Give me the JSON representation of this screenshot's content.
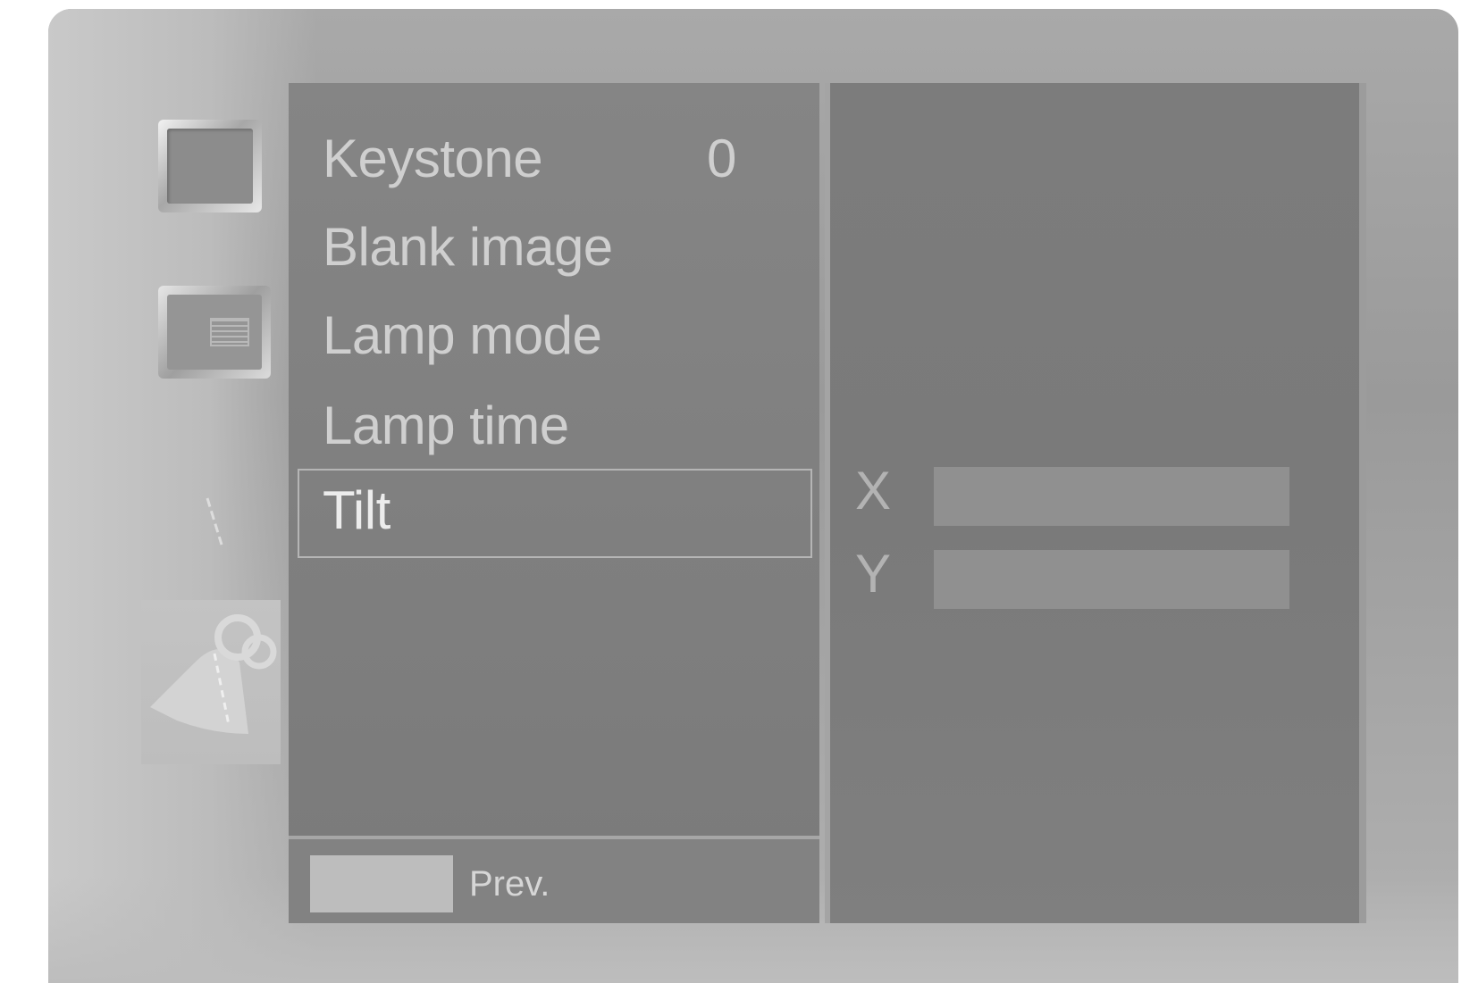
{
  "sidebar": {
    "icons": [
      {
        "name": "picture-icon"
      },
      {
        "name": "menu-icon"
      },
      {
        "name": "option-icon"
      },
      {
        "name": "bell-icon"
      }
    ]
  },
  "menu": {
    "items": [
      {
        "label": "Keystone",
        "value": "0"
      },
      {
        "label": "Blank image"
      },
      {
        "label": "Lamp mode"
      },
      {
        "label": "Lamp time"
      },
      {
        "label": "Tilt",
        "selected": true
      }
    ]
  },
  "footer": {
    "prev_label": "Prev."
  },
  "tilt": {
    "x_label": "X",
    "y_label": "Y",
    "x_level": 1.0,
    "y_level": 1.0
  },
  "colors": {
    "panel": "#7a7a7a",
    "text": "#cfcfcf",
    "highlight_border": "#b5b5b5"
  }
}
